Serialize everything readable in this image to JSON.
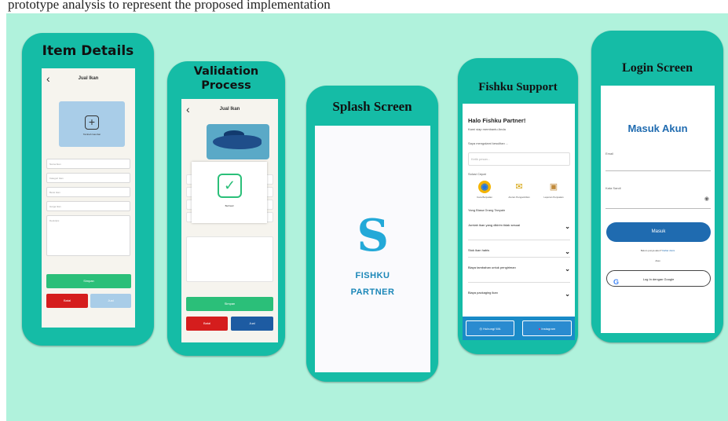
{
  "caption": "prototype analysis to represent the proposed implementation",
  "item_details": {
    "title": "Item Details",
    "screen_header": "Jual Ikan",
    "upload_label": "Tambah Gambar",
    "fields": [
      "Nama Ikan",
      "Kategori Ikan",
      "Berat Ikan",
      "Harga Ikan",
      "Deskripsi"
    ],
    "submit_label": "Simpan",
    "cancel_label": "Batal",
    "save_label": "Jual"
  },
  "validation": {
    "title_line1": "Validation",
    "title_line2": "Process",
    "screen_header": "Jual Ikan",
    "success_label": "Berhasil",
    "submit_label": "Simpan",
    "cancel_label": "Batal",
    "save_label": "Jual"
  },
  "splash": {
    "title": "Splash Screen",
    "logo_glyph": "S",
    "brand_line1": "FISHKU",
    "brand_line2": "PARTNER",
    "logo_color": "#23a9d8"
  },
  "support": {
    "title": "Fishku Support",
    "greeting": "Halo Fishku Partner!",
    "help_text": "Kami siap membantu Anda",
    "problem_text": "Saya mengalami kesulitan ...",
    "input_placeholder": "Ketik pesan...",
    "quick_solution": "Solusi Cepat",
    "solutions": [
      "Cara Berjualan",
      "Aturan Pengambilan",
      "Laporan Penjualan"
    ],
    "faq_heading": "Yang Biasa Orang Tanyain",
    "faqs": [
      "Jumlah ikan yang dikirim tidak sesuai",
      "Stok ikan habis",
      "Biaya tambahan untuk pengiriman",
      "Biaya packaging ikan"
    ],
    "chat_label": "Hubungi WA",
    "instagram_label": "Instagram"
  },
  "login": {
    "title": "Login Screen",
    "heading": "Masuk Akun",
    "email_label": "Email",
    "password_label": "Kata Sandi",
    "login_button": "Masuk",
    "register_text": "Belum punya akun?",
    "register_link": "Daftar disini",
    "or_text": "Atau",
    "google_button": "Log In dengan Google",
    "primary_color": "#1f6bb0"
  },
  "colors": {
    "background": "#b0f2dc",
    "phone_frame": "#15bca6",
    "green_button": "#2bbf79",
    "red_button": "#d51d1d",
    "blue_button": "#1d5ba2"
  }
}
